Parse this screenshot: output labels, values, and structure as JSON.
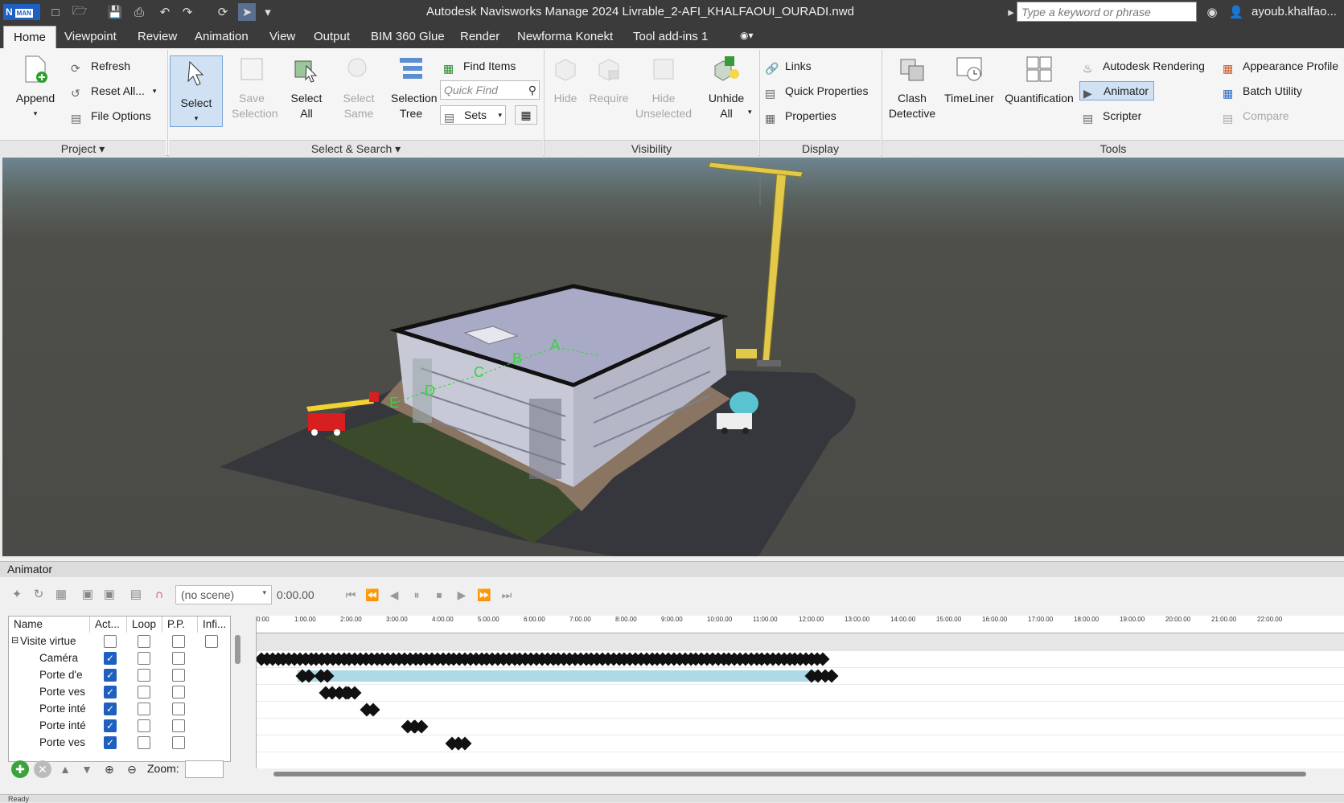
{
  "app": {
    "title": "Autodesk Navisworks Manage 2024   Livrable_2-AFI_KHALFAOUI_OURADI.nwd",
    "logo": "N",
    "logo_badge": "MAN",
    "search_placeholder": "Type a keyword or phrase",
    "user": "ayoub.khalfao..."
  },
  "menu": [
    "Home",
    "Viewpoint",
    "Review",
    "Animation",
    "View",
    "Output",
    "BIM 360 Glue",
    "Render",
    "Newforma Konekt",
    "Tool add-ins 1"
  ],
  "ribbon": {
    "project": {
      "label": "Project",
      "append": "Append",
      "refresh": "Refresh",
      "reset_all": "Reset All...",
      "file_options": "File Options"
    },
    "select_search": {
      "label": "Select & Search",
      "select": "Select",
      "save_selection": "Save Selection",
      "select_all": "Select All",
      "select_same": "Select Same",
      "selection_tree": "Selection Tree",
      "find_items": "Find Items",
      "quick_find_placeholder": "Quick Find",
      "sets": "Sets"
    },
    "visibility": {
      "label": "Visibility",
      "hide": "Hide",
      "require": "Require",
      "hide_unselected": "Hide Unselected",
      "unhide_all": "Unhide All"
    },
    "display": {
      "label": "Display",
      "links": "Links",
      "quick_properties": "Quick Properties",
      "properties": "Properties"
    },
    "tools": {
      "label": "Tools",
      "clash_detective": "Clash Detective",
      "timeliner": "TimeLiner",
      "quantification": "Quantification",
      "autodesk_rendering": "Autodesk Rendering",
      "animator": "Animator",
      "scripter": "Scripter",
      "appearance_profiler": "Appearance Profile",
      "batch_utility": "Batch Utility",
      "compare": "Compare"
    }
  },
  "viewport": {
    "labels": [
      "A",
      "B",
      "C",
      "D",
      "E"
    ]
  },
  "animator": {
    "title": "Animator",
    "scene": "(no scene)",
    "time": "0:00.00",
    "columns": [
      "Name",
      "Act...",
      "Loop",
      "P.P.",
      "Infi..."
    ],
    "rows": [
      {
        "name": "Visite virtue",
        "active": false,
        "loop": false,
        "pp": false,
        "infinite": false,
        "root": true
      },
      {
        "name": "Caméra",
        "active": true,
        "loop": false,
        "pp": false
      },
      {
        "name": "Porte d'e",
        "active": true,
        "loop": false,
        "pp": false
      },
      {
        "name": "Porte ves",
        "active": true,
        "loop": false,
        "pp": false
      },
      {
        "name": "Porte inté",
        "active": true,
        "loop": false,
        "pp": false
      },
      {
        "name": "Porte inté",
        "active": true,
        "loop": false,
        "pp": false
      },
      {
        "name": "Porte ves",
        "active": true,
        "loop": false,
        "pp": false
      }
    ],
    "ticks": [
      "0:00",
      "1:00.00",
      "2:00.00",
      "3:00.00",
      "4:00.00",
      "5:00.00",
      "6:00.00",
      "7:00.00",
      "8:00.00",
      "9:00.00",
      "10:00.00",
      "11:00.00",
      "12:00.00",
      "13:00.00",
      "14:00.00",
      "15:00.00",
      "16:00.00",
      "17:00.00",
      "18:00.00",
      "19:00.00",
      "20:00.00",
      "21:00.00",
      "22:00.00"
    ],
    "tracks": [
      {
        "row": 1,
        "type": "dense",
        "start": 0.0,
        "end": 12.35
      },
      {
        "row": 2,
        "type": "bar",
        "start": 0.9,
        "end": 12.3,
        "keys": [
          0.9,
          1.3,
          12.0,
          12.3
        ]
      },
      {
        "row": 3,
        "type": "keys",
        "keys": [
          1.4,
          1.7,
          1.9
        ]
      },
      {
        "row": 4,
        "type": "keys",
        "keys": [
          2.3
        ]
      },
      {
        "row": 5,
        "type": "keys",
        "keys": [
          3.2,
          3.35
        ]
      },
      {
        "row": 6,
        "type": "keys",
        "keys": [
          4.15,
          4.3
        ]
      }
    ],
    "zoom_label": "Zoom:",
    "colors": {
      "bar": "#acd9e6",
      "keyframe": "#111111",
      "active": "#1f5fbf"
    }
  },
  "status": "Ready"
}
